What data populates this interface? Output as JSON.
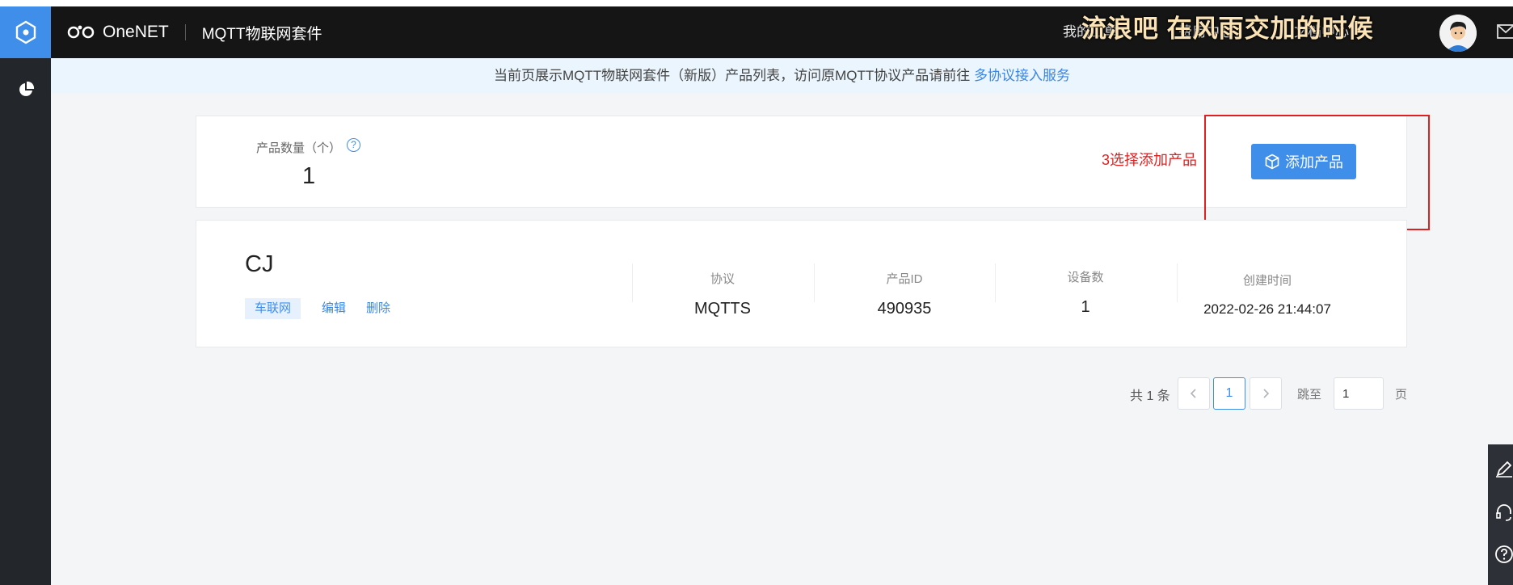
{
  "topbar": {
    "brand_name": "OneNET",
    "suite_title": "MQTT物联网套件",
    "nav": [
      "我的工单",
      "费用中心",
      "文档中心"
    ],
    "overlay_banner": "流浪吧 在风雨交加的时候"
  },
  "notice": {
    "text": "当前页展示MQTT物联网套件（新版）产品列表，访问原MQTT协议产品请前往",
    "link": "多协议接入服务"
  },
  "summary": {
    "count_label": "产品数量（个）",
    "help_glyph": "?",
    "count_value": "1",
    "add_button_label": "添加产品",
    "annotation": "3选择添加产品"
  },
  "product": {
    "name": "CJ",
    "tag": "车联网",
    "actions": {
      "edit": "编辑",
      "delete": "删除"
    },
    "columns": [
      {
        "header": "协议",
        "value": "MQTTS"
      },
      {
        "header": "产品ID",
        "value": "490935"
      },
      {
        "header": "设备数",
        "value": "1"
      },
      {
        "header": "创建时间",
        "value": "2022-02-26 21:44:07"
      }
    ]
  },
  "pagination": {
    "total": "共 1 条",
    "current_page": "1",
    "jump_label": "跳至",
    "jump_value": "1",
    "page_suffix": "页"
  },
  "colors": {
    "accent": "#3f8eea",
    "topbar": "#151515",
    "rail": "#23262b",
    "annotation": "#e02020",
    "notice_bg": "#eaf5fd"
  },
  "icons": [
    "onenet-hub-icon",
    "pie-chart-icon",
    "cube-icon",
    "chevron-left-icon",
    "chevron-right-icon",
    "mail-icon",
    "edit-icon",
    "headset-icon",
    "help-circle-icon"
  ]
}
